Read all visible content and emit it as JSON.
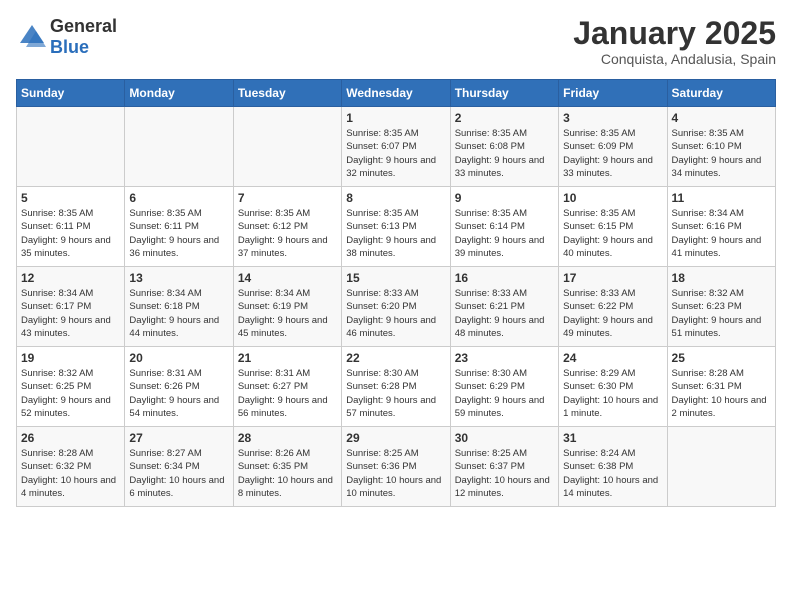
{
  "logo": {
    "general": "General",
    "blue": "Blue"
  },
  "title": "January 2025",
  "location": "Conquista, Andalusia, Spain",
  "weekdays": [
    "Sunday",
    "Monday",
    "Tuesday",
    "Wednesday",
    "Thursday",
    "Friday",
    "Saturday"
  ],
  "weeks": [
    [
      {
        "day": "",
        "sunrise": "",
        "sunset": "",
        "daylight": ""
      },
      {
        "day": "",
        "sunrise": "",
        "sunset": "",
        "daylight": ""
      },
      {
        "day": "",
        "sunrise": "",
        "sunset": "",
        "daylight": ""
      },
      {
        "day": "1",
        "sunrise": "Sunrise: 8:35 AM",
        "sunset": "Sunset: 6:07 PM",
        "daylight": "Daylight: 9 hours and 32 minutes."
      },
      {
        "day": "2",
        "sunrise": "Sunrise: 8:35 AM",
        "sunset": "Sunset: 6:08 PM",
        "daylight": "Daylight: 9 hours and 33 minutes."
      },
      {
        "day": "3",
        "sunrise": "Sunrise: 8:35 AM",
        "sunset": "Sunset: 6:09 PM",
        "daylight": "Daylight: 9 hours and 33 minutes."
      },
      {
        "day": "4",
        "sunrise": "Sunrise: 8:35 AM",
        "sunset": "Sunset: 6:10 PM",
        "daylight": "Daylight: 9 hours and 34 minutes."
      }
    ],
    [
      {
        "day": "5",
        "sunrise": "Sunrise: 8:35 AM",
        "sunset": "Sunset: 6:11 PM",
        "daylight": "Daylight: 9 hours and 35 minutes."
      },
      {
        "day": "6",
        "sunrise": "Sunrise: 8:35 AM",
        "sunset": "Sunset: 6:11 PM",
        "daylight": "Daylight: 9 hours and 36 minutes."
      },
      {
        "day": "7",
        "sunrise": "Sunrise: 8:35 AM",
        "sunset": "Sunset: 6:12 PM",
        "daylight": "Daylight: 9 hours and 37 minutes."
      },
      {
        "day": "8",
        "sunrise": "Sunrise: 8:35 AM",
        "sunset": "Sunset: 6:13 PM",
        "daylight": "Daylight: 9 hours and 38 minutes."
      },
      {
        "day": "9",
        "sunrise": "Sunrise: 8:35 AM",
        "sunset": "Sunset: 6:14 PM",
        "daylight": "Daylight: 9 hours and 39 minutes."
      },
      {
        "day": "10",
        "sunrise": "Sunrise: 8:35 AM",
        "sunset": "Sunset: 6:15 PM",
        "daylight": "Daylight: 9 hours and 40 minutes."
      },
      {
        "day": "11",
        "sunrise": "Sunrise: 8:34 AM",
        "sunset": "Sunset: 6:16 PM",
        "daylight": "Daylight: 9 hours and 41 minutes."
      }
    ],
    [
      {
        "day": "12",
        "sunrise": "Sunrise: 8:34 AM",
        "sunset": "Sunset: 6:17 PM",
        "daylight": "Daylight: 9 hours and 43 minutes."
      },
      {
        "day": "13",
        "sunrise": "Sunrise: 8:34 AM",
        "sunset": "Sunset: 6:18 PM",
        "daylight": "Daylight: 9 hours and 44 minutes."
      },
      {
        "day": "14",
        "sunrise": "Sunrise: 8:34 AM",
        "sunset": "Sunset: 6:19 PM",
        "daylight": "Daylight: 9 hours and 45 minutes."
      },
      {
        "day": "15",
        "sunrise": "Sunrise: 8:33 AM",
        "sunset": "Sunset: 6:20 PM",
        "daylight": "Daylight: 9 hours and 46 minutes."
      },
      {
        "day": "16",
        "sunrise": "Sunrise: 8:33 AM",
        "sunset": "Sunset: 6:21 PM",
        "daylight": "Daylight: 9 hours and 48 minutes."
      },
      {
        "day": "17",
        "sunrise": "Sunrise: 8:33 AM",
        "sunset": "Sunset: 6:22 PM",
        "daylight": "Daylight: 9 hours and 49 minutes."
      },
      {
        "day": "18",
        "sunrise": "Sunrise: 8:32 AM",
        "sunset": "Sunset: 6:23 PM",
        "daylight": "Daylight: 9 hours and 51 minutes."
      }
    ],
    [
      {
        "day": "19",
        "sunrise": "Sunrise: 8:32 AM",
        "sunset": "Sunset: 6:25 PM",
        "daylight": "Daylight: 9 hours and 52 minutes."
      },
      {
        "day": "20",
        "sunrise": "Sunrise: 8:31 AM",
        "sunset": "Sunset: 6:26 PM",
        "daylight": "Daylight: 9 hours and 54 minutes."
      },
      {
        "day": "21",
        "sunrise": "Sunrise: 8:31 AM",
        "sunset": "Sunset: 6:27 PM",
        "daylight": "Daylight: 9 hours and 56 minutes."
      },
      {
        "day": "22",
        "sunrise": "Sunrise: 8:30 AM",
        "sunset": "Sunset: 6:28 PM",
        "daylight": "Daylight: 9 hours and 57 minutes."
      },
      {
        "day": "23",
        "sunrise": "Sunrise: 8:30 AM",
        "sunset": "Sunset: 6:29 PM",
        "daylight": "Daylight: 9 hours and 59 minutes."
      },
      {
        "day": "24",
        "sunrise": "Sunrise: 8:29 AM",
        "sunset": "Sunset: 6:30 PM",
        "daylight": "Daylight: 10 hours and 1 minute."
      },
      {
        "day": "25",
        "sunrise": "Sunrise: 8:28 AM",
        "sunset": "Sunset: 6:31 PM",
        "daylight": "Daylight: 10 hours and 2 minutes."
      }
    ],
    [
      {
        "day": "26",
        "sunrise": "Sunrise: 8:28 AM",
        "sunset": "Sunset: 6:32 PM",
        "daylight": "Daylight: 10 hours and 4 minutes."
      },
      {
        "day": "27",
        "sunrise": "Sunrise: 8:27 AM",
        "sunset": "Sunset: 6:34 PM",
        "daylight": "Daylight: 10 hours and 6 minutes."
      },
      {
        "day": "28",
        "sunrise": "Sunrise: 8:26 AM",
        "sunset": "Sunset: 6:35 PM",
        "daylight": "Daylight: 10 hours and 8 minutes."
      },
      {
        "day": "29",
        "sunrise": "Sunrise: 8:25 AM",
        "sunset": "Sunset: 6:36 PM",
        "daylight": "Daylight: 10 hours and 10 minutes."
      },
      {
        "day": "30",
        "sunrise": "Sunrise: 8:25 AM",
        "sunset": "Sunset: 6:37 PM",
        "daylight": "Daylight: 10 hours and 12 minutes."
      },
      {
        "day": "31",
        "sunrise": "Sunrise: 8:24 AM",
        "sunset": "Sunset: 6:38 PM",
        "daylight": "Daylight: 10 hours and 14 minutes."
      },
      {
        "day": "",
        "sunrise": "",
        "sunset": "",
        "daylight": ""
      }
    ]
  ]
}
